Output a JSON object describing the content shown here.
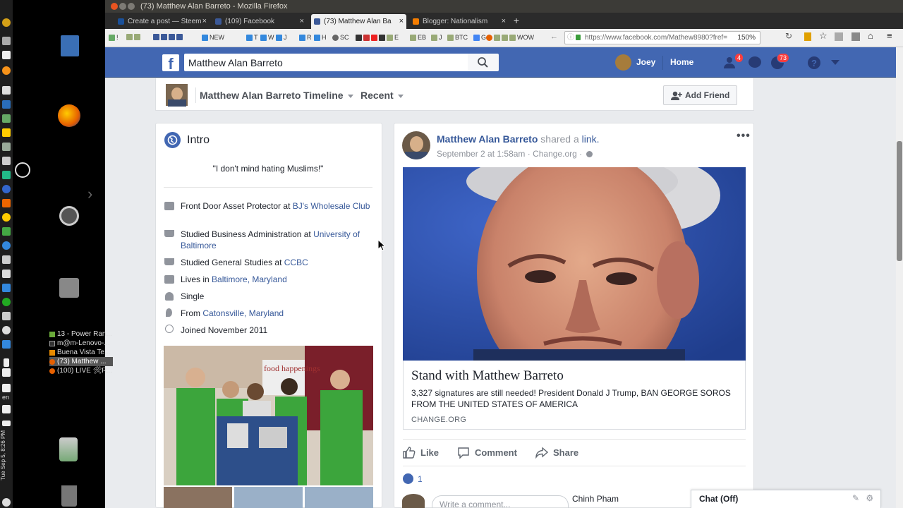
{
  "window": {
    "title": "(73) Matthew Alan Barreto - Mozilla Firefox"
  },
  "tabs": [
    {
      "label": "Create a post — Steem",
      "favicon_color": "#1a5099"
    },
    {
      "label": "(109) Facebook",
      "favicon_color": "#3b5998"
    },
    {
      "label": "(73) Matthew Alan Ba",
      "favicon_color": "#3b5998",
      "active": true
    },
    {
      "label": "Blogger: Nationalism",
      "favicon_color": "#f57d00"
    }
  ],
  "bookmarks": [
    "!",
    "NEW",
    "T",
    "W",
    "J",
    "R",
    "H",
    "SC",
    "E",
    "EB",
    "J",
    "BTC",
    "G",
    "WOW"
  ],
  "url": {
    "value": "https://www.facebook.com/Mathew8980?fref=",
    "zoom": "150%"
  },
  "desktop": {
    "windows": [
      {
        "label": "13 - Power Ran...",
        "color": "#6aaa3a"
      },
      {
        "label": "m@m-Lenovo-...",
        "color": "#333333"
      },
      {
        "label": "Buena Vista Te...",
        "color": "#e68a00"
      },
      {
        "label": "(73) Matthew ...",
        "color": "#e66000",
        "selected": true
      },
      {
        "label": "(100) LIVE 🛠R...",
        "color": "#e66000"
      }
    ],
    "clock": "Tue Sep 5, 8:26 PM",
    "lang": "en"
  },
  "fb": {
    "logo": "f",
    "search_value": "Matthew Alan Barreto",
    "user_name": "Joey",
    "home_label": "Home",
    "friend_requests": "4",
    "notifications": "73",
    "brand_color": "#4267b2"
  },
  "profile": {
    "name": "Matthew Alan Barreto",
    "timeline_label": "Timeline",
    "recent_label": "Recent",
    "add_friend_label": "Add Friend"
  },
  "intro": {
    "title": "Intro",
    "quote": "\"I don't mind hating Muslims!\"",
    "items": [
      {
        "icon": "briefcase-icon",
        "text": "Front Door Asset Protector at ",
        "link": "BJ's Wholesale Club"
      },
      {
        "icon": "graduation-cap-icon",
        "text": "Studied Business Administration at ",
        "link": "University of Baltimore"
      },
      {
        "icon": "graduation-cap-icon",
        "text": "Studied General Studies at ",
        "link": "CCBC"
      },
      {
        "icon": "home-icon",
        "text": "Lives in ",
        "link": "Baltimore, Maryland"
      },
      {
        "icon": "heart-icon",
        "text": "Single",
        "link": ""
      },
      {
        "icon": "location-pin-icon",
        "text": "From ",
        "link": "Catonsville, Maryland"
      },
      {
        "icon": "clock-icon",
        "text": "Joined November 2011",
        "link": ""
      }
    ],
    "photo_sign": "food happenings"
  },
  "post": {
    "author": "Matthew Alan Barreto",
    "shared_text": "shared a",
    "link_word": "link.",
    "timestamp": "September 2 at 1:58am · Change.org ·",
    "link_title": "Stand with Matthew Barreto",
    "link_desc": "3,327 signatures are still needed! President Donald J Trump, BAN GEORGE SOROS FROM THE UNITED STATES OF AMERICA",
    "link_domain": "CHANGE.ORG",
    "like_label": "Like",
    "comment_label": "Comment",
    "share_label": "Share",
    "like_count": "1",
    "comment_placeholder": "Write a comment..."
  },
  "chat": {
    "label": "Chat (Off)",
    "contact": "Chinh Pham"
  }
}
